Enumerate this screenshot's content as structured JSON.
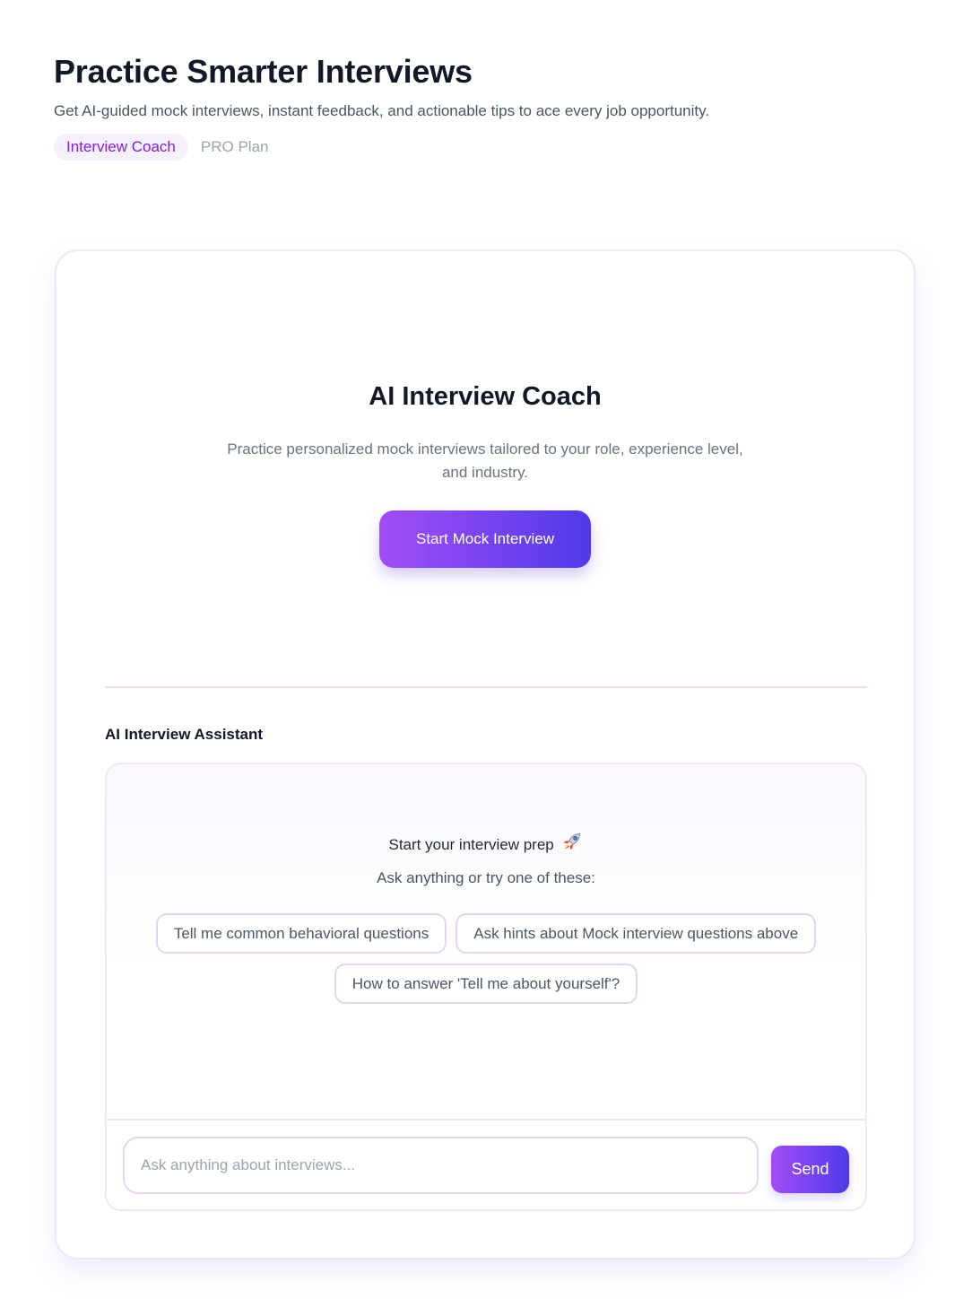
{
  "header": {
    "title": "Practice Smarter Interviews",
    "subtitle": "Get AI-guided mock interviews, instant feedback, and actionable tips to ace every job opportunity.",
    "badges": [
      "Interview Coach",
      "PRO Plan"
    ]
  },
  "coach": {
    "title": "AI Interview Coach",
    "description": "Practice personalized mock interviews tailored to your role, experience level, and industry.",
    "cta_label": "Start Mock Interview"
  },
  "assistant": {
    "section_label": "AI Interview Assistant",
    "intro_title": "Start your interview prep",
    "intro_icon": "rocket-icon",
    "intro_subtitle": "Ask anything or try one of these:",
    "suggestions": [
      "Tell me common behavioral questions",
      "Ask hints about Mock interview questions above",
      "How to answer 'Tell me about yourself'?"
    ],
    "input": {
      "value": "",
      "placeholder": "Ask anything about interviews..."
    },
    "send_label": "Send"
  },
  "colors": {
    "accent_start": "#a24df6",
    "accent_end": "#4f3aea",
    "badge_text": "#7e22ce",
    "badge_bg": "#f5f0fc"
  }
}
